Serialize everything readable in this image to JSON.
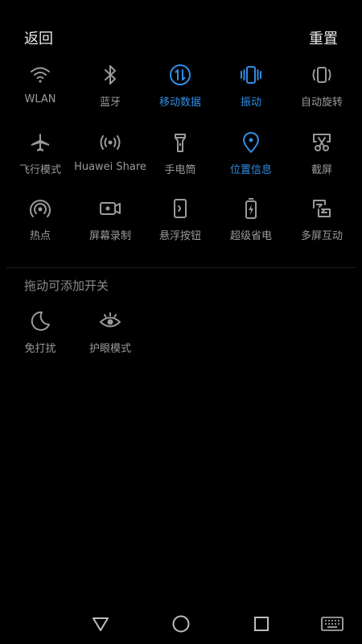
{
  "header": {
    "back_label": "返回",
    "reset_label": "重置"
  },
  "colors": {
    "accent": "#2f8de4",
    "inactive": "#9a9a9a",
    "background": "#000000"
  },
  "active_toggles": {
    "items": [
      {
        "label": "WLAN",
        "icon": "wifi-icon",
        "active": false
      },
      {
        "label": "蓝牙",
        "icon": "bluetooth-icon",
        "active": false
      },
      {
        "label": "移动数据",
        "icon": "mobile-data-icon",
        "active": true
      },
      {
        "label": "振动",
        "icon": "vibrate-icon",
        "active": true
      },
      {
        "label": "自动旋转",
        "icon": "auto-rotate-icon",
        "active": false
      },
      {
        "label": "飞行模式",
        "icon": "airplane-icon",
        "active": false
      },
      {
        "label": "Huawei Share",
        "icon": "huawei-share-icon",
        "active": false
      },
      {
        "label": "手电筒",
        "icon": "flashlight-icon",
        "active": false
      },
      {
        "label": "位置信息",
        "icon": "location-icon",
        "active": true
      },
      {
        "label": "截屏",
        "icon": "screenshot-icon",
        "active": false
      },
      {
        "label": "热点",
        "icon": "hotspot-icon",
        "active": false
      },
      {
        "label": "屏幕录制",
        "icon": "screen-record-icon",
        "active": false
      },
      {
        "label": "悬浮按钮",
        "icon": "floating-button-icon",
        "active": false
      },
      {
        "label": "超级省电",
        "icon": "power-saving-icon",
        "active": false
      },
      {
        "label": "多屏互动",
        "icon": "multi-screen-icon",
        "active": false
      }
    ]
  },
  "available_toggles": {
    "title": "拖动可添加开关",
    "items": [
      {
        "label": "免打扰",
        "icon": "do-not-disturb-icon",
        "active": false
      },
      {
        "label": "护眼模式",
        "icon": "eye-comfort-icon",
        "active": false
      }
    ]
  },
  "navbar": {
    "buttons": [
      "back-nav-icon",
      "home-nav-icon",
      "recents-nav-icon",
      "keyboard-icon"
    ]
  }
}
